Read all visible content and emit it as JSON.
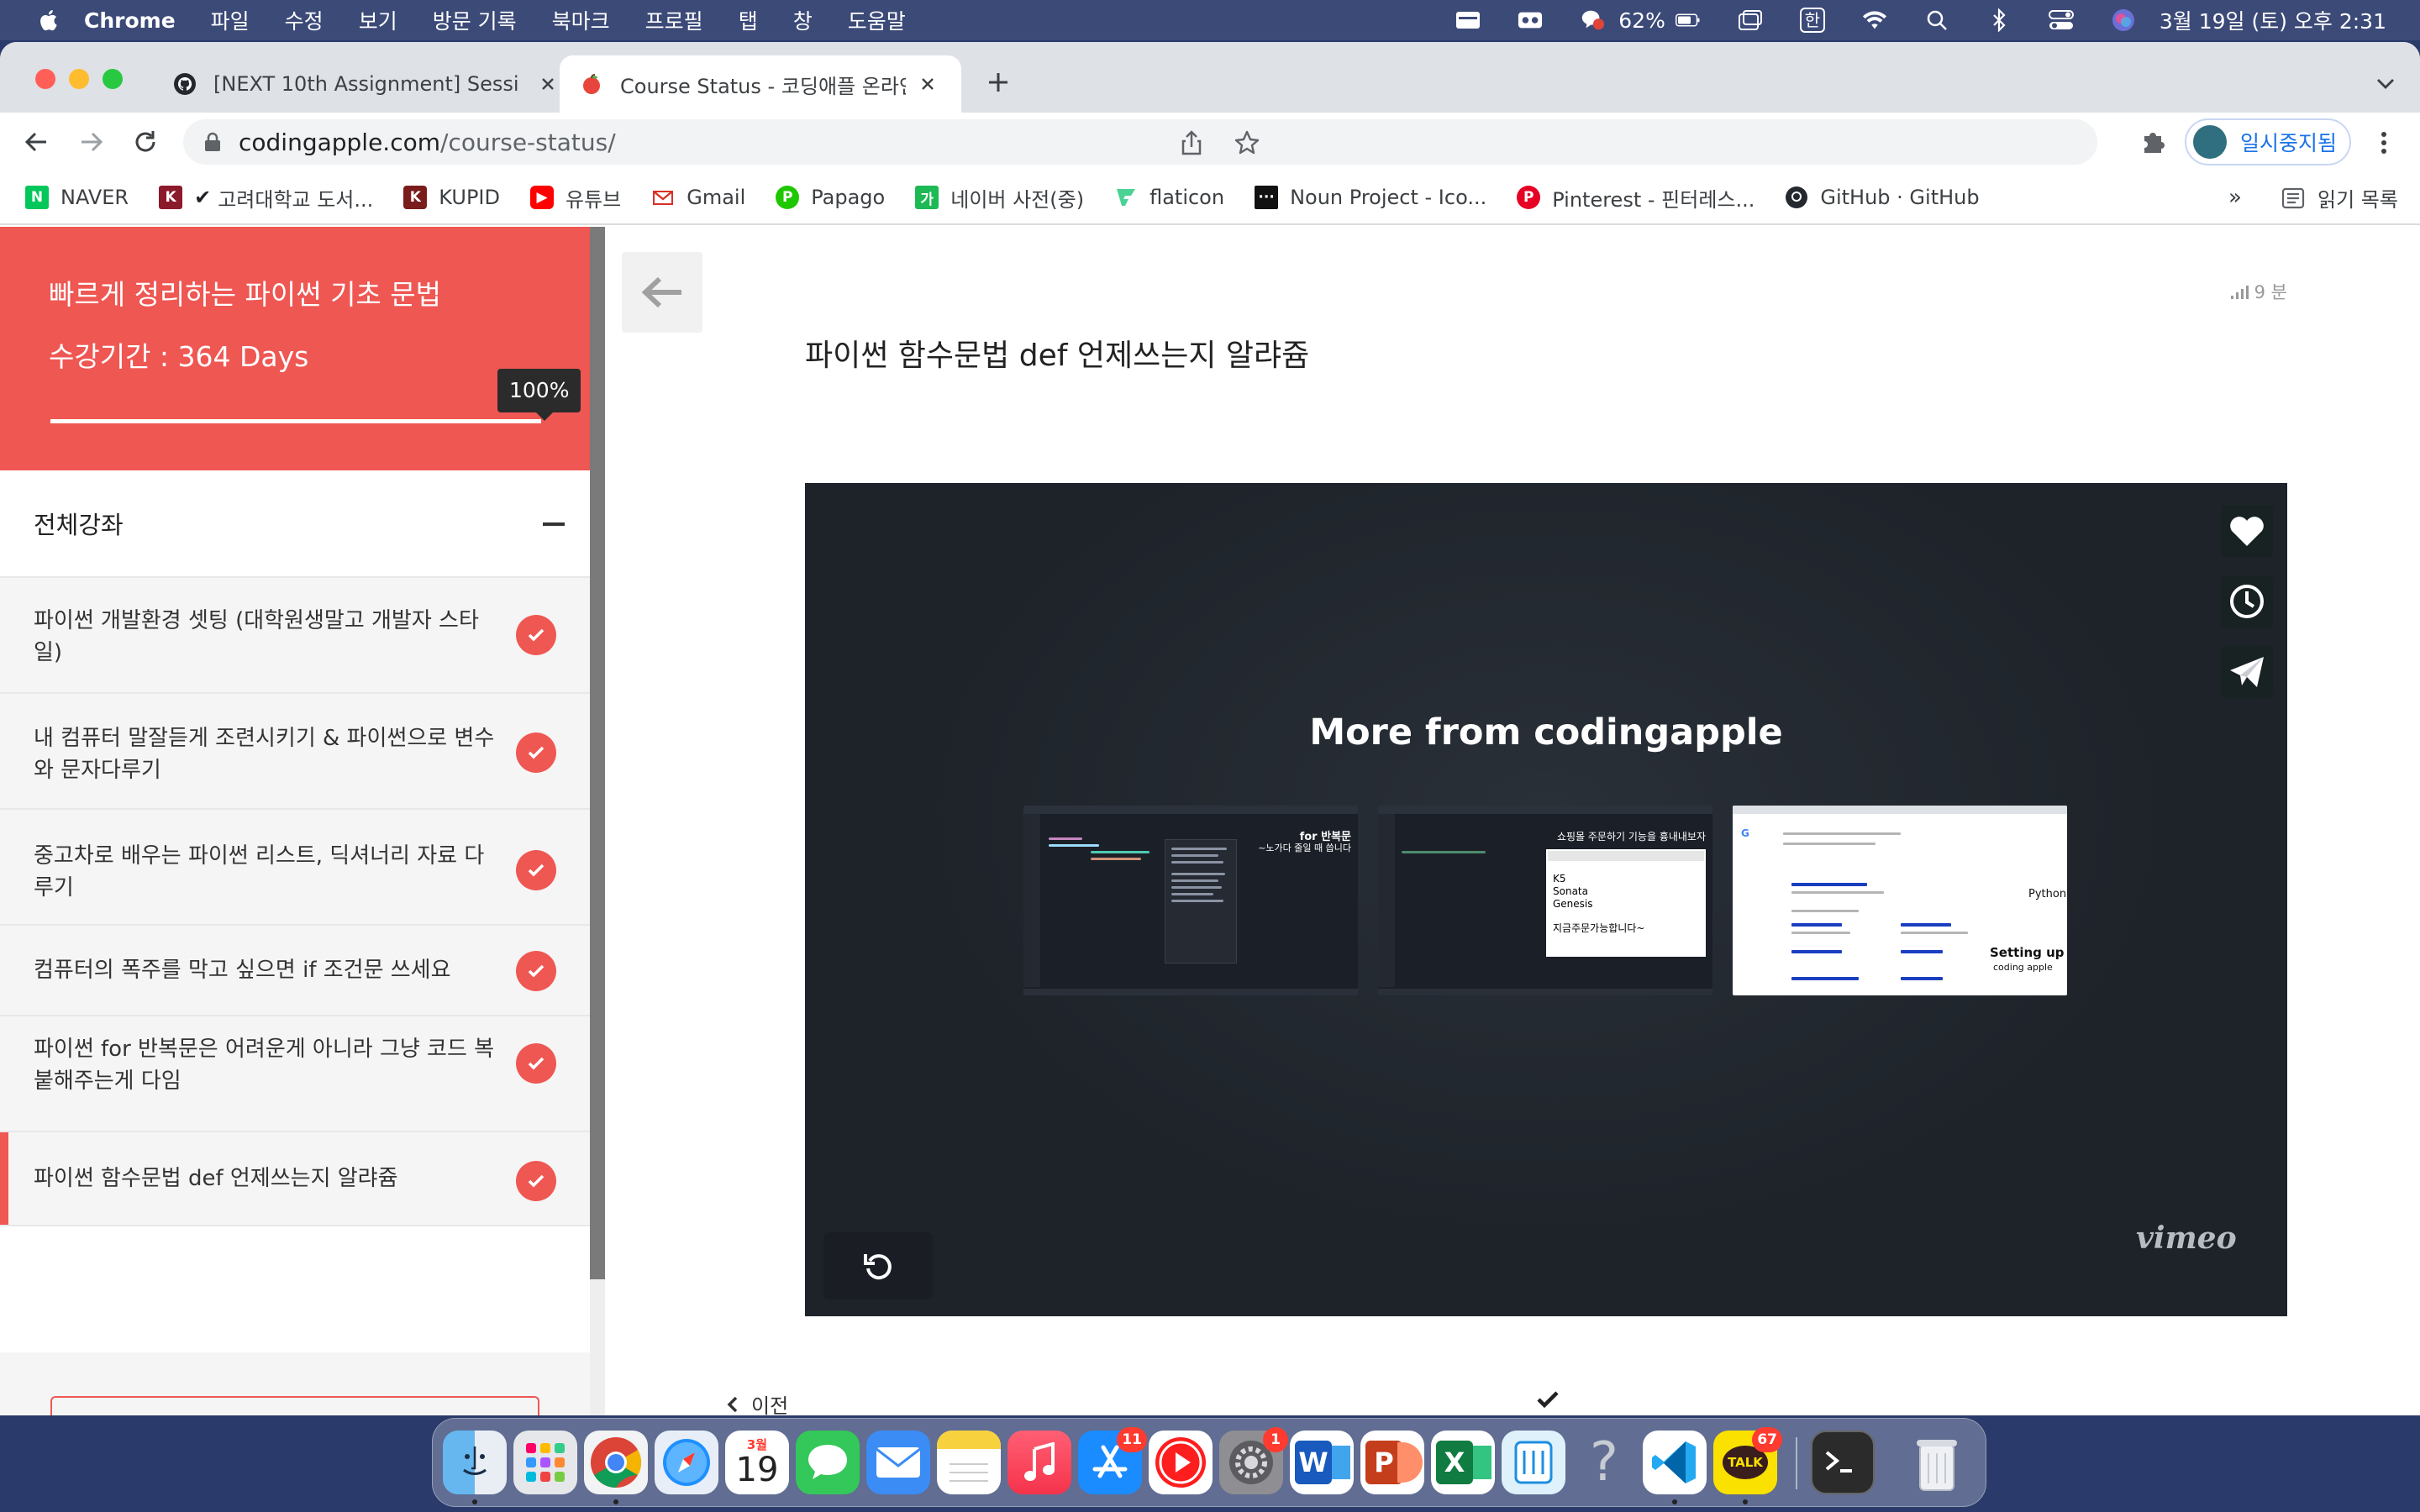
{
  "menubar": {
    "items": [
      "Chrome",
      "파일",
      "수정",
      "보기",
      "방문 기록",
      "북마크",
      "프로필",
      "탭",
      "창",
      "도움말"
    ],
    "battery": "62%",
    "input_source": "한",
    "datetime": "3월 19일 (토) 오후 2:31"
  },
  "tabs": [
    {
      "title": "[NEXT 10th Assignment] Sessi",
      "icon": "github-icon",
      "active": false
    },
    {
      "title": "Course Status - 코딩애플 온라인",
      "icon": "apple-favicon-icon",
      "active": true
    }
  ],
  "address": {
    "host": "codingapple.com",
    "path": "/course-status/"
  },
  "profile": {
    "label": "일시중지됨"
  },
  "bookmarks": [
    {
      "label": "NAVER",
      "icon": "naver-icon"
    },
    {
      "label": "고려대학교 도서...",
      "icon": "korea-univ-icon"
    },
    {
      "label": "KUPID",
      "icon": "kupid-icon"
    },
    {
      "label": "유튜브",
      "icon": "youtube-icon"
    },
    {
      "label": "Gmail",
      "icon": "gmail-icon"
    },
    {
      "label": "Papago",
      "icon": "papago-icon"
    },
    {
      "label": "네이버 사전(중)",
      "icon": "naver-dict-icon"
    },
    {
      "label": "flaticon",
      "icon": "flaticon-icon"
    },
    {
      "label": "Noun Project - Ico...",
      "icon": "noun-project-icon"
    },
    {
      "label": "Pinterest - 핀터레스...",
      "icon": "pinterest-icon"
    },
    {
      "label": "GitHub · GitHub",
      "icon": "github-icon"
    }
  ],
  "bookmarks_more": "»",
  "reading_list": "읽기 목록",
  "course": {
    "title": "빠르게 정리하는 파이썬 기초 문법",
    "period": "수강기간 : 364 Days",
    "progress_label": "100%",
    "progress": 1.0
  },
  "sidebar_header": "전체강좌",
  "lectures": [
    {
      "title": "파이썬 개발환경 셋팅 (대학원생말고 개발자 스타일)",
      "done": true
    },
    {
      "title": "내 컴퓨터 말잘듣게 조련시키기 & 파이썬으로 변수와 문자다루기",
      "done": true
    },
    {
      "title": "중고차로 배우는 파이썬 리스트, 딕셔너리 자료 다루기",
      "done": true
    },
    {
      "title": "컴퓨터의 폭주를 막고 싶으면 if 조건문 쓰세요",
      "done": true
    },
    {
      "title": "파이썬 for 반복문은 어려운게 아니라 그냥 코드 복붙해주는게 다임",
      "done": true
    },
    {
      "title": "파이썬 함수문법 def 언제쓰는지 알랴쥼",
      "done": true,
      "active": true
    }
  ],
  "lesson": {
    "duration": "9 분",
    "title": "파이썬 함수문법 def 언제쓰는지 알랴쥼"
  },
  "player": {
    "heading": "More from codingapple",
    "thumbs": [
      {
        "caption": "for 반복문",
        "subcaption": "~노가다 줄일 때 씁니다"
      },
      {
        "caption": "쇼핑몰 주문하기 기능을 흉내내보자",
        "panel": [
          "K5",
          "Sonata",
          "Genesis",
          "지금주문가능합니다~"
        ]
      },
      {
        "caption": "Setting up",
        "subcaption": "coding apple",
        "side_label": "Python"
      }
    ],
    "brand": "vimeo"
  },
  "nav": {
    "prev": "이전"
  },
  "dock": {
    "apps": [
      {
        "name": "finder-icon"
      },
      {
        "name": "launchpad-icon"
      },
      {
        "name": "chrome-icon"
      },
      {
        "name": "safari-icon"
      },
      {
        "name": "calendar-icon",
        "month": "3월",
        "day": "19"
      },
      {
        "name": "messages-icon"
      },
      {
        "name": "mail-icon"
      },
      {
        "name": "notes-icon"
      },
      {
        "name": "music-icon"
      },
      {
        "name": "app-store-icon",
        "badge": "11"
      },
      {
        "name": "youtube-app-icon"
      },
      {
        "name": "system-preferences-icon",
        "badge": "1"
      },
      {
        "name": "word-icon"
      },
      {
        "name": "powerpoint-icon"
      },
      {
        "name": "excel-icon"
      },
      {
        "name": "file-app-icon"
      },
      {
        "name": "help-icon"
      },
      {
        "name": "vscode-icon"
      },
      {
        "name": "kakaotalk-icon",
        "label": "TALK",
        "badge": "67"
      },
      {
        "name": "terminal-icon"
      },
      {
        "name": "trash-icon"
      }
    ]
  }
}
